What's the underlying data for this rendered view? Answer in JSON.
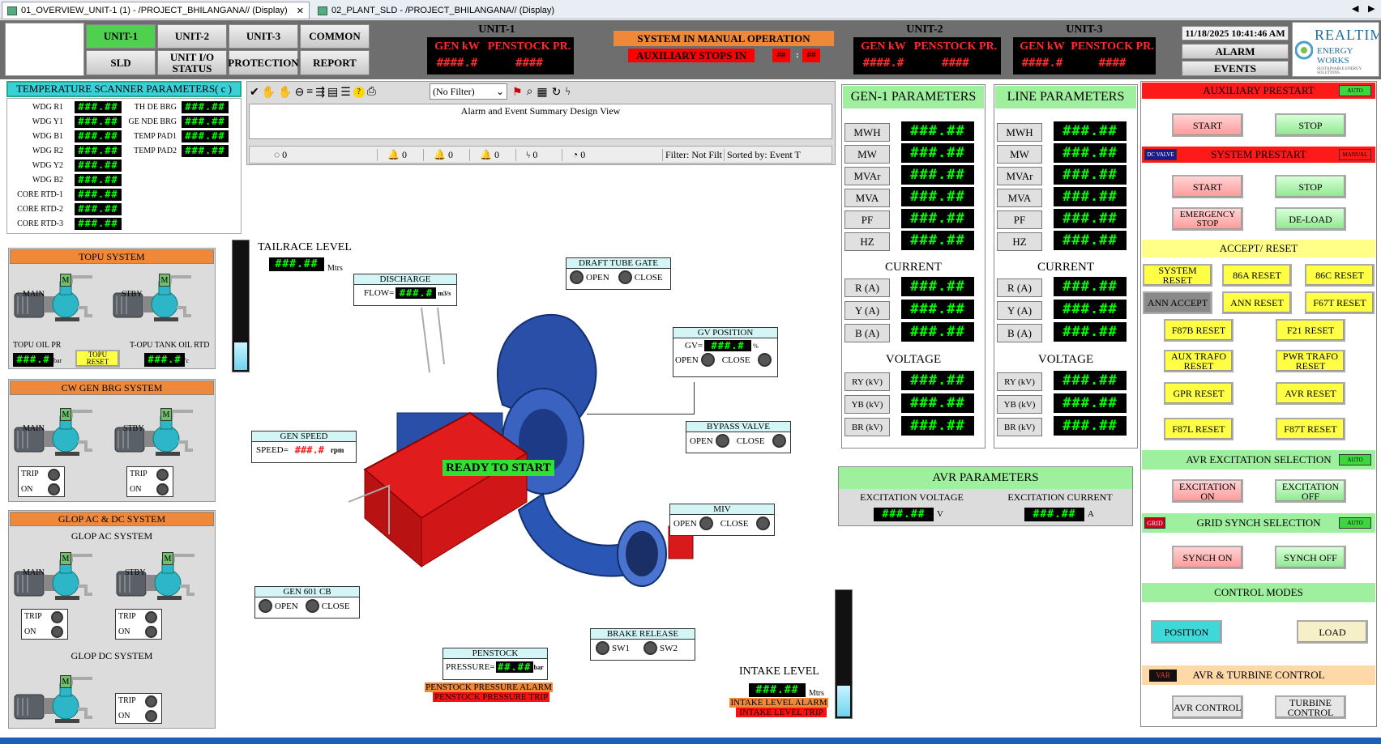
{
  "tabs": [
    {
      "label": "01_OVERVIEW_UNIT-1 (1) - /PROJECT_BHILANGANA// (Display)"
    },
    {
      "label": "02_PLANT_SLD - /PROJECT_BHILANGANA// (Display)"
    }
  ],
  "nav": {
    "unit1": "UNIT-1",
    "unit2": "UNIT-2",
    "unit3": "UNIT-3",
    "common": "COMMON",
    "sld": "SLD",
    "unit_io": "UNIT I/O STATUS",
    "protection": "PROTECTION",
    "report": "REPORT"
  },
  "header": {
    "units": [
      {
        "name": "UNIT-1",
        "gen_label": "GEN kW",
        "pen_label": "PENSTOCK PR.",
        "gen_val": "####.#",
        "pen_val": "####"
      },
      {
        "name": "UNIT-2",
        "gen_label": "GEN kW",
        "pen_label": "PENSTOCK PR.",
        "gen_val": "####.#",
        "pen_val": "####"
      },
      {
        "name": "UNIT-3",
        "gen_label": "GEN kW",
        "pen_label": "PENSTOCK PR.",
        "gen_val": "####.#",
        "pen_val": "####"
      }
    ],
    "manual": "SYSTEM IN MANUAL OPERATION",
    "aux_stops": "AUXILIARY STOPS IN",
    "aux_mm": "##",
    "aux_sep": ":",
    "aux_ss": "##",
    "datetime": "11/18/2025 10:41:46 AM",
    "alarm": "ALARM",
    "events": "EVENTS",
    "logo_line1": "REALTIME",
    "logo_line2": "ENERGY WORKS",
    "logo_line3": "SUSTAINABLE ENERGY SOLUTIONS"
  },
  "temp": {
    "title": "TEMPERATURE SCANNER PARAMETERS( c )",
    "left": [
      {
        "l": "WDG R1",
        "v": "###.##"
      },
      {
        "l": "WDG Y1",
        "v": "###.##"
      },
      {
        "l": "WDG B1",
        "v": "###.##"
      },
      {
        "l": "WDG R2",
        "v": "###.##"
      },
      {
        "l": "WDG Y2",
        "v": "###.##"
      },
      {
        "l": "WDG B2",
        "v": "###.##"
      },
      {
        "l": "CORE RTD-1",
        "v": "###.##"
      },
      {
        "l": "CORE RTD-2",
        "v": "###.##"
      },
      {
        "l": "CORE RTD-3",
        "v": "###.##"
      }
    ],
    "right": [
      {
        "l": "TH DE BRG",
        "v": "###.##"
      },
      {
        "l": "GE NDE BRG",
        "v": "###.##"
      },
      {
        "l": "TEMP PAD1",
        "v": "###.##"
      },
      {
        "l": "TEMP PAD2",
        "v": "###.##"
      }
    ]
  },
  "alarmview": {
    "filter": "(No Filter)",
    "caption": "Alarm and Event Summary Design View",
    "counts": [
      "0",
      "0",
      "0",
      "0",
      "0",
      "0"
    ],
    "filter_status": "Filter: Not Filt",
    "sort_status": "Sorted by: Event T"
  },
  "topu": {
    "title": "TOPU SYSTEM",
    "main": "MAIN",
    "stby": "STBY",
    "m": "M",
    "oil_pr": "TOPU OIL PR",
    "oil_pr_val": "###.#",
    "oil_pr_unit": "bar",
    "reset": "TOPU RESET",
    "tank": "T-OPU TANK OIL RTD",
    "tank_val": "###.#",
    "tank_unit": "'c"
  },
  "cw": {
    "title": "CW GEN BRG SYSTEM",
    "main": "MAIN",
    "stby": "STBY",
    "trip": "TRIP",
    "on": "ON"
  },
  "glop": {
    "title": "GLOP AC & DC SYSTEM",
    "ac": "GLOP AC SYSTEM",
    "dc": "GLOP DC SYSTEM",
    "main": "MAIN",
    "stby": "STBY",
    "trip": "TRIP",
    "on": "ON"
  },
  "center": {
    "tailrace": "TAILRACE LEVEL",
    "tailrace_val": "###.##",
    "tailrace_unit": "Mtrs",
    "discharge": "DISCHARGE",
    "flow_lbl": "FLOW=",
    "flow_val": "###.#",
    "flow_unit": "m3/s",
    "dtg": "DRAFT TUBE GATE",
    "open": "OPEN",
    "close": "CLOSE",
    "gv": "GV POSITION",
    "gv_lbl": "GV=",
    "gv_val": "###.#",
    "gv_unit": "%",
    "bypass": "BYPASS VALVE",
    "speed": "GEN SPEED",
    "speed_lbl": "SPEED=",
    "speed_val": "###.#",
    "speed_unit": "rpm",
    "ready": "READY TO START",
    "miv": "MIV",
    "cb": "GEN 601 CB",
    "brake": "BRAKE RELEASE",
    "sw1": "SW1",
    "sw2": "SW2",
    "penstock": "PENSTOCK",
    "press_lbl": "PRESSURE=",
    "press_val": "##.##",
    "press_unit": "bar",
    "pen_alarm": "PENSTOCK PRESSURE ALARM",
    "pen_trip": "PENSTOCK PRESSURE TRIP",
    "intake": "INTAKE LEVEL",
    "intake_val": "###.##",
    "intake_unit": "Mtrs",
    "intake_alarm": "INTAKE LEVEL ALARM",
    "intake_trip": "INTAKE LEVEL TRIP"
  },
  "gen1": {
    "title": "GEN-1 PARAMETERS",
    "rows": [
      {
        "l": "MWH",
        "v": "###.##"
      },
      {
        "l": "MW",
        "v": "###.##"
      },
      {
        "l": "MVAr",
        "v": "###.##"
      },
      {
        "l": "MVA",
        "v": "###.##"
      },
      {
        "l": "PF",
        "v": "###.##"
      },
      {
        "l": "HZ",
        "v": "###.##"
      }
    ],
    "current": "CURRENT",
    "crows": [
      {
        "l": "R (A)",
        "v": "###.##"
      },
      {
        "l": "Y (A)",
        "v": "###.##"
      },
      {
        "l": "B (A)",
        "v": "###.##"
      }
    ],
    "voltage": "VOLTAGE",
    "vrows": [
      {
        "l": "RY (kV)",
        "v": "###.##"
      },
      {
        "l": "YB (kV)",
        "v": "###.##"
      },
      {
        "l": "BR (kV)",
        "v": "###.##"
      }
    ]
  },
  "line": {
    "title": "LINE PARAMETERS",
    "rows": [
      {
        "l": "MWH",
        "v": "###.##"
      },
      {
        "l": "MW",
        "v": "###.##"
      },
      {
        "l": "MVAr",
        "v": "###.##"
      },
      {
        "l": "MVA",
        "v": "###.##"
      },
      {
        "l": "PF",
        "v": "###.##"
      },
      {
        "l": "HZ",
        "v": "###.##"
      }
    ],
    "current": "CURRENT",
    "crows": [
      {
        "l": "R (A)",
        "v": "###.##"
      },
      {
        "l": "Y (A)",
        "v": "###.##"
      },
      {
        "l": "B (A)",
        "v": "###.##"
      }
    ],
    "voltage": "VOLTAGE",
    "vrows": [
      {
        "l": "RY (kV)",
        "v": "###.##"
      },
      {
        "l": "YB (kV)",
        "v": "###.##"
      },
      {
        "l": "BR (kV)",
        "v": "###.##"
      }
    ]
  },
  "avr": {
    "title": "AVR PARAMETERS",
    "ev": "EXCITATION VOLTAGE",
    "ec": "EXCITATION CURRENT",
    "ev_val": "###.##",
    "ec_val": "###.##",
    "ev_unit": "V",
    "ec_unit": "A"
  },
  "right": {
    "aux": "AUXILIARY PRESTART",
    "auto": "AUTO",
    "start": "START",
    "stop": "STOP",
    "dcvalve": "DC VALVE",
    "sysprestart": "SYSTEM PRESTART",
    "manual": "MANUAL",
    "estop": "EMERGENCY STOP",
    "deload": "DE-LOAD",
    "accept": "ACCEPT/ RESET",
    "resets": [
      "SYSTEM RESET",
      "86A RESET",
      "86C RESET",
      "ANN ACCEPT",
      "ANN RESET",
      "F67T RESET",
      "F87B RESET",
      "F21 RESET",
      "AUX TRAFO RESET",
      "PWR TRAFO RESET",
      "GPR RESET",
      "AVR RESET",
      "F87L RESET",
      "F87T RESET"
    ],
    "avrexc": "AVR EXCITATION SELECTION",
    "exc_on": "EXCITATION ON",
    "exc_off": "EXCITATION OFF",
    "grid": "GRID",
    "gridsynch": "GRID SYNCH SELECTION",
    "synch_on": "SYNCH ON",
    "synch_off": "SYNCH OFF",
    "ctrl": "CONTROL MODES",
    "position": "POSITION",
    "load": "LOAD",
    "var": "VAR",
    "avrturb": "AVR & TURBINE CONTROL",
    "avr_ctrl": "AVR CONTROL",
    "turb_ctrl": "TURBINE CONTROL"
  }
}
